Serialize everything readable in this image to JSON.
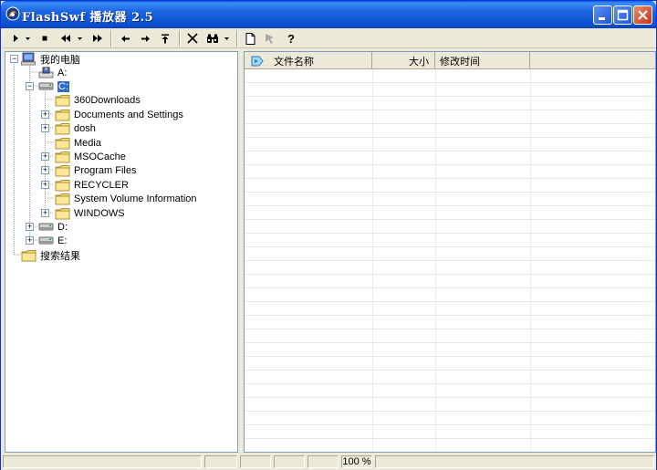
{
  "window": {
    "title": "FlashSwf 播放器 2.5",
    "colors": {
      "titlebar": "#0b4fd0",
      "selection": "#316ac5",
      "chrome": "#ece9d8"
    }
  },
  "toolbar": {
    "buttons": [
      {
        "name": "play-button",
        "icon": "play-icon"
      },
      {
        "name": "play-dropdown-button",
        "icon": "dropdown-arrow-icon"
      },
      {
        "name": "stop-button",
        "icon": "stop-icon"
      },
      {
        "name": "rewind-button",
        "icon": "rewind-icon"
      },
      {
        "name": "rewind-dropdown-button",
        "icon": "dropdown-arrow-icon"
      },
      {
        "name": "fast-forward-button",
        "icon": "fast-forward-icon"
      },
      {
        "name": "back-button",
        "icon": "arrow-left-icon"
      },
      {
        "name": "forward-button",
        "icon": "arrow-right-icon"
      },
      {
        "name": "up-folder-button",
        "icon": "arrow-up-bar-icon"
      },
      {
        "name": "delete-button",
        "icon": "x-icon"
      },
      {
        "name": "find-button",
        "icon": "binoculars-icon"
      },
      {
        "name": "find-dropdown-button",
        "icon": "dropdown-arrow-icon"
      },
      {
        "name": "new-file-button",
        "icon": "document-icon"
      },
      {
        "name": "pointer-button",
        "icon": "pointer-icon"
      },
      {
        "name": "help-button",
        "icon": "help-icon",
        "label": "?"
      }
    ]
  },
  "tree": {
    "items": [
      {
        "label": "我的电脑",
        "icon": "computer-icon",
        "level": 0,
        "expander": "-"
      },
      {
        "label": "A:",
        "icon": "floppy-drive-icon",
        "level": 1,
        "expander": ""
      },
      {
        "label": "C:",
        "icon": "hard-drive-icon",
        "level": 1,
        "expander": "-",
        "selected": true
      },
      {
        "label": "360Downloads",
        "icon": "folder-icon",
        "level": 2,
        "expander": ""
      },
      {
        "label": "Documents and Settings",
        "icon": "folder-icon",
        "level": 2,
        "expander": "+"
      },
      {
        "label": "dosh",
        "icon": "folder-icon",
        "level": 2,
        "expander": "+"
      },
      {
        "label": "Media",
        "icon": "folder-icon",
        "level": 2,
        "expander": ""
      },
      {
        "label": "MSOCache",
        "icon": "folder-icon",
        "level": 2,
        "expander": "+"
      },
      {
        "label": "Program Files",
        "icon": "folder-icon",
        "level": 2,
        "expander": "+"
      },
      {
        "label": "RECYCLER",
        "icon": "folder-icon",
        "level": 2,
        "expander": "+"
      },
      {
        "label": "System Volume Information",
        "icon": "folder-icon",
        "level": 2,
        "expander": ""
      },
      {
        "label": "WINDOWS",
        "icon": "folder-icon",
        "level": 2,
        "expander": "+"
      },
      {
        "label": "D:",
        "icon": "hard-drive-icon",
        "level": 1,
        "expander": "+"
      },
      {
        "label": "E:",
        "icon": "hard-drive-icon",
        "level": 1,
        "expander": "+"
      },
      {
        "label": "搜索结果",
        "icon": "search-results-folder-icon",
        "level": 0,
        "expander": ""
      }
    ]
  },
  "file_list": {
    "header_icon": "flash-file-icon",
    "columns": [
      {
        "label": "文件名称",
        "align": "left"
      },
      {
        "label": "大小",
        "align": "right"
      },
      {
        "label": "修改时间",
        "align": "left"
      }
    ],
    "rows": []
  },
  "status": {
    "zoom": "100 %"
  }
}
